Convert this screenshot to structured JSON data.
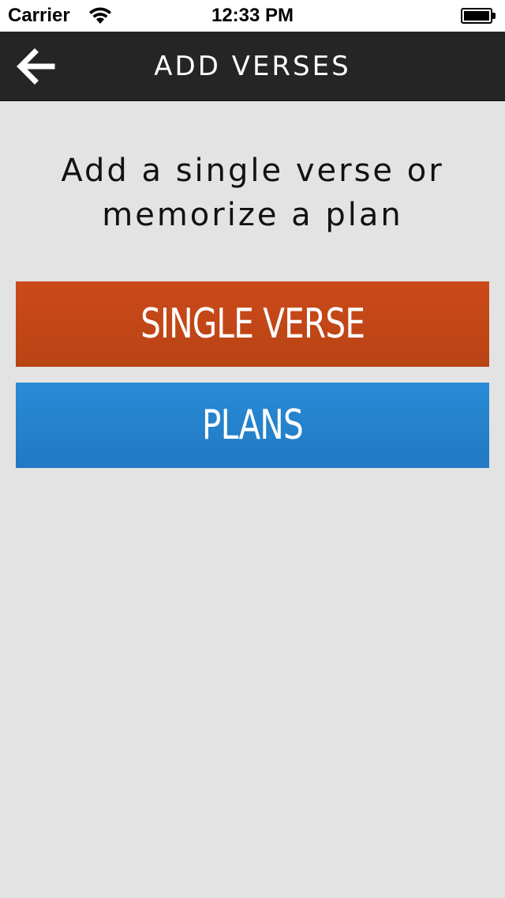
{
  "status_bar": {
    "carrier": "Carrier",
    "time": "12:33 PM"
  },
  "nav": {
    "back_icon": "arrow-left-icon",
    "title": "ADD VERSES"
  },
  "main": {
    "prompt_line1": "Add a single verse or",
    "prompt_line2": "memorize a plan",
    "single_verse_label": "SINGLE VERSE",
    "plans_label": "PLANS"
  },
  "colors": {
    "nav_background": "#252525",
    "page_background": "#e3e3e3",
    "single_verse_button": "#c64716",
    "plans_button": "#2584cf"
  }
}
